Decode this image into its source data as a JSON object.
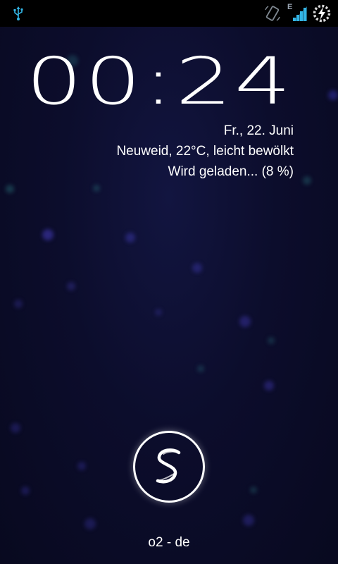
{
  "status_bar": {
    "icons": [
      "usb-icon",
      "screen-rotation-icon",
      "signal-icon",
      "battery-charging-icon"
    ],
    "network_type": "E",
    "accent_color": "#33b5e5"
  },
  "lockscreen": {
    "clock": "00:24",
    "date": "Fr., 22. Juni",
    "weather": "Neuweid, 22°C, leicht bewölkt",
    "charging": "Wird geladen... (8 %)",
    "unlock_icon": "unlock-ring-icon",
    "carrier": "o2 - de"
  }
}
